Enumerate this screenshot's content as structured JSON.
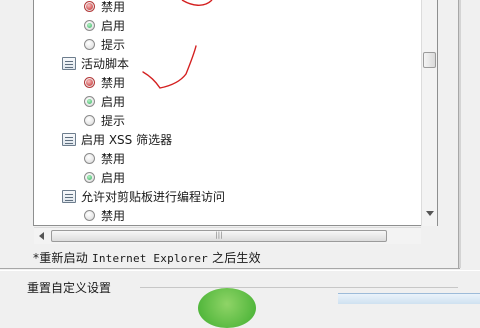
{
  "list": {
    "rows": [
      {
        "kind": "radio",
        "label": "禁用",
        "state": "selected-marked"
      },
      {
        "kind": "radio",
        "label": "启用",
        "state": "checked"
      },
      {
        "kind": "radio",
        "label": "提示",
        "state": "unchecked"
      },
      {
        "kind": "setting",
        "label": "活动脚本"
      },
      {
        "kind": "radio",
        "label": "禁用",
        "state": "selected-marked"
      },
      {
        "kind": "radio",
        "label": "启用",
        "state": "checked"
      },
      {
        "kind": "radio",
        "label": "提示",
        "state": "unchecked"
      },
      {
        "kind": "setting",
        "label": "启用 XSS 筛选器"
      },
      {
        "kind": "radio",
        "label": "禁用",
        "state": "unchecked"
      },
      {
        "kind": "radio",
        "label": "启用",
        "state": "checked"
      },
      {
        "kind": "setting",
        "label": "允许对剪贴板进行编程访问"
      },
      {
        "kind": "radio",
        "label": "禁用",
        "state": "unchecked"
      },
      {
        "kind": "radio",
        "label": "启用",
        "state": "checked"
      }
    ]
  },
  "scrollbar_h": {
    "grip": "|||"
  },
  "note": {
    "prefix": "*重新启动 ",
    "product": "Internet Explorer",
    "suffix": " 之后生效"
  },
  "section": {
    "label": "重置自定义设置"
  },
  "colors": {
    "annotation_red": "#d42020",
    "radio_green": "#31b35e",
    "radio_red": "#c42a2a"
  }
}
